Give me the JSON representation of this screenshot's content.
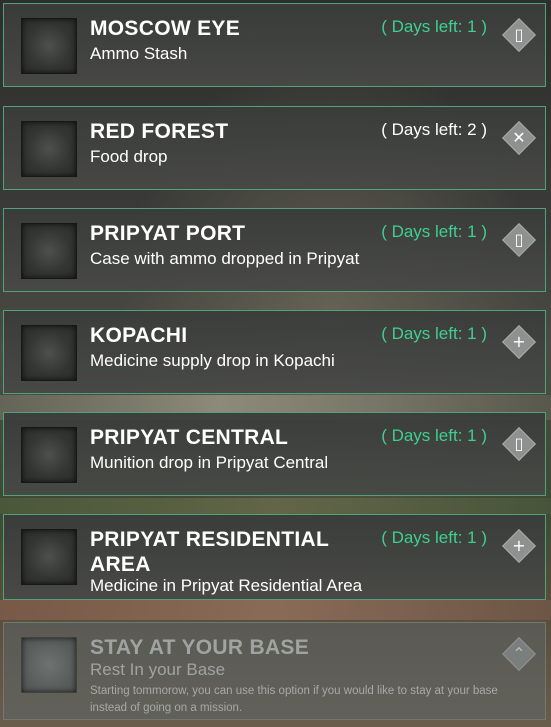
{
  "missions": [
    {
      "title": "MOSCOW EYE",
      "subtitle": "Ammo Stash",
      "days": "( Days left: 1 )",
      "icon": "ammo-icon",
      "glyph": "▯"
    },
    {
      "title": "RED FOREST",
      "subtitle": "Food drop",
      "days": "( Days left: 2 )",
      "icon": "food-icon",
      "glyph": "✕"
    },
    {
      "title": "PRIPYAT PORT",
      "subtitle": "Case with ammo dropped in Pripyat",
      "days": "( Days left: 1 )",
      "icon": "ammo-icon",
      "glyph": "▯"
    },
    {
      "title": "KOPACHI",
      "subtitle": "Medicine supply drop in Kopachi",
      "days": "( Days left: 1 )",
      "icon": "medicine-icon",
      "glyph": "+"
    },
    {
      "title": "PRIPYAT CENTRAL",
      "subtitle": "Munition drop in Pripyat Central",
      "days": "( Days left: 1 )",
      "icon": "ammo-icon",
      "glyph": "▯"
    },
    {
      "title": "PRIPYAT RESIDENTIAL AREA",
      "subtitle": "Medicine in Pripyat Residential Area",
      "days": "( Days left: 1 )",
      "icon": "medicine-icon",
      "glyph": "+"
    }
  ],
  "stay": {
    "title": "STAY AT YOUR BASE",
    "subtitle": "Rest In your Base",
    "description": "Starting tommorow, you can use this option if you would like to stay at your base instead of going on a mission.",
    "icon": "chevron-up-icon",
    "glyph": "⌃"
  },
  "colors": {
    "accent": "#3fcf8f",
    "border": "#4fa27a"
  }
}
